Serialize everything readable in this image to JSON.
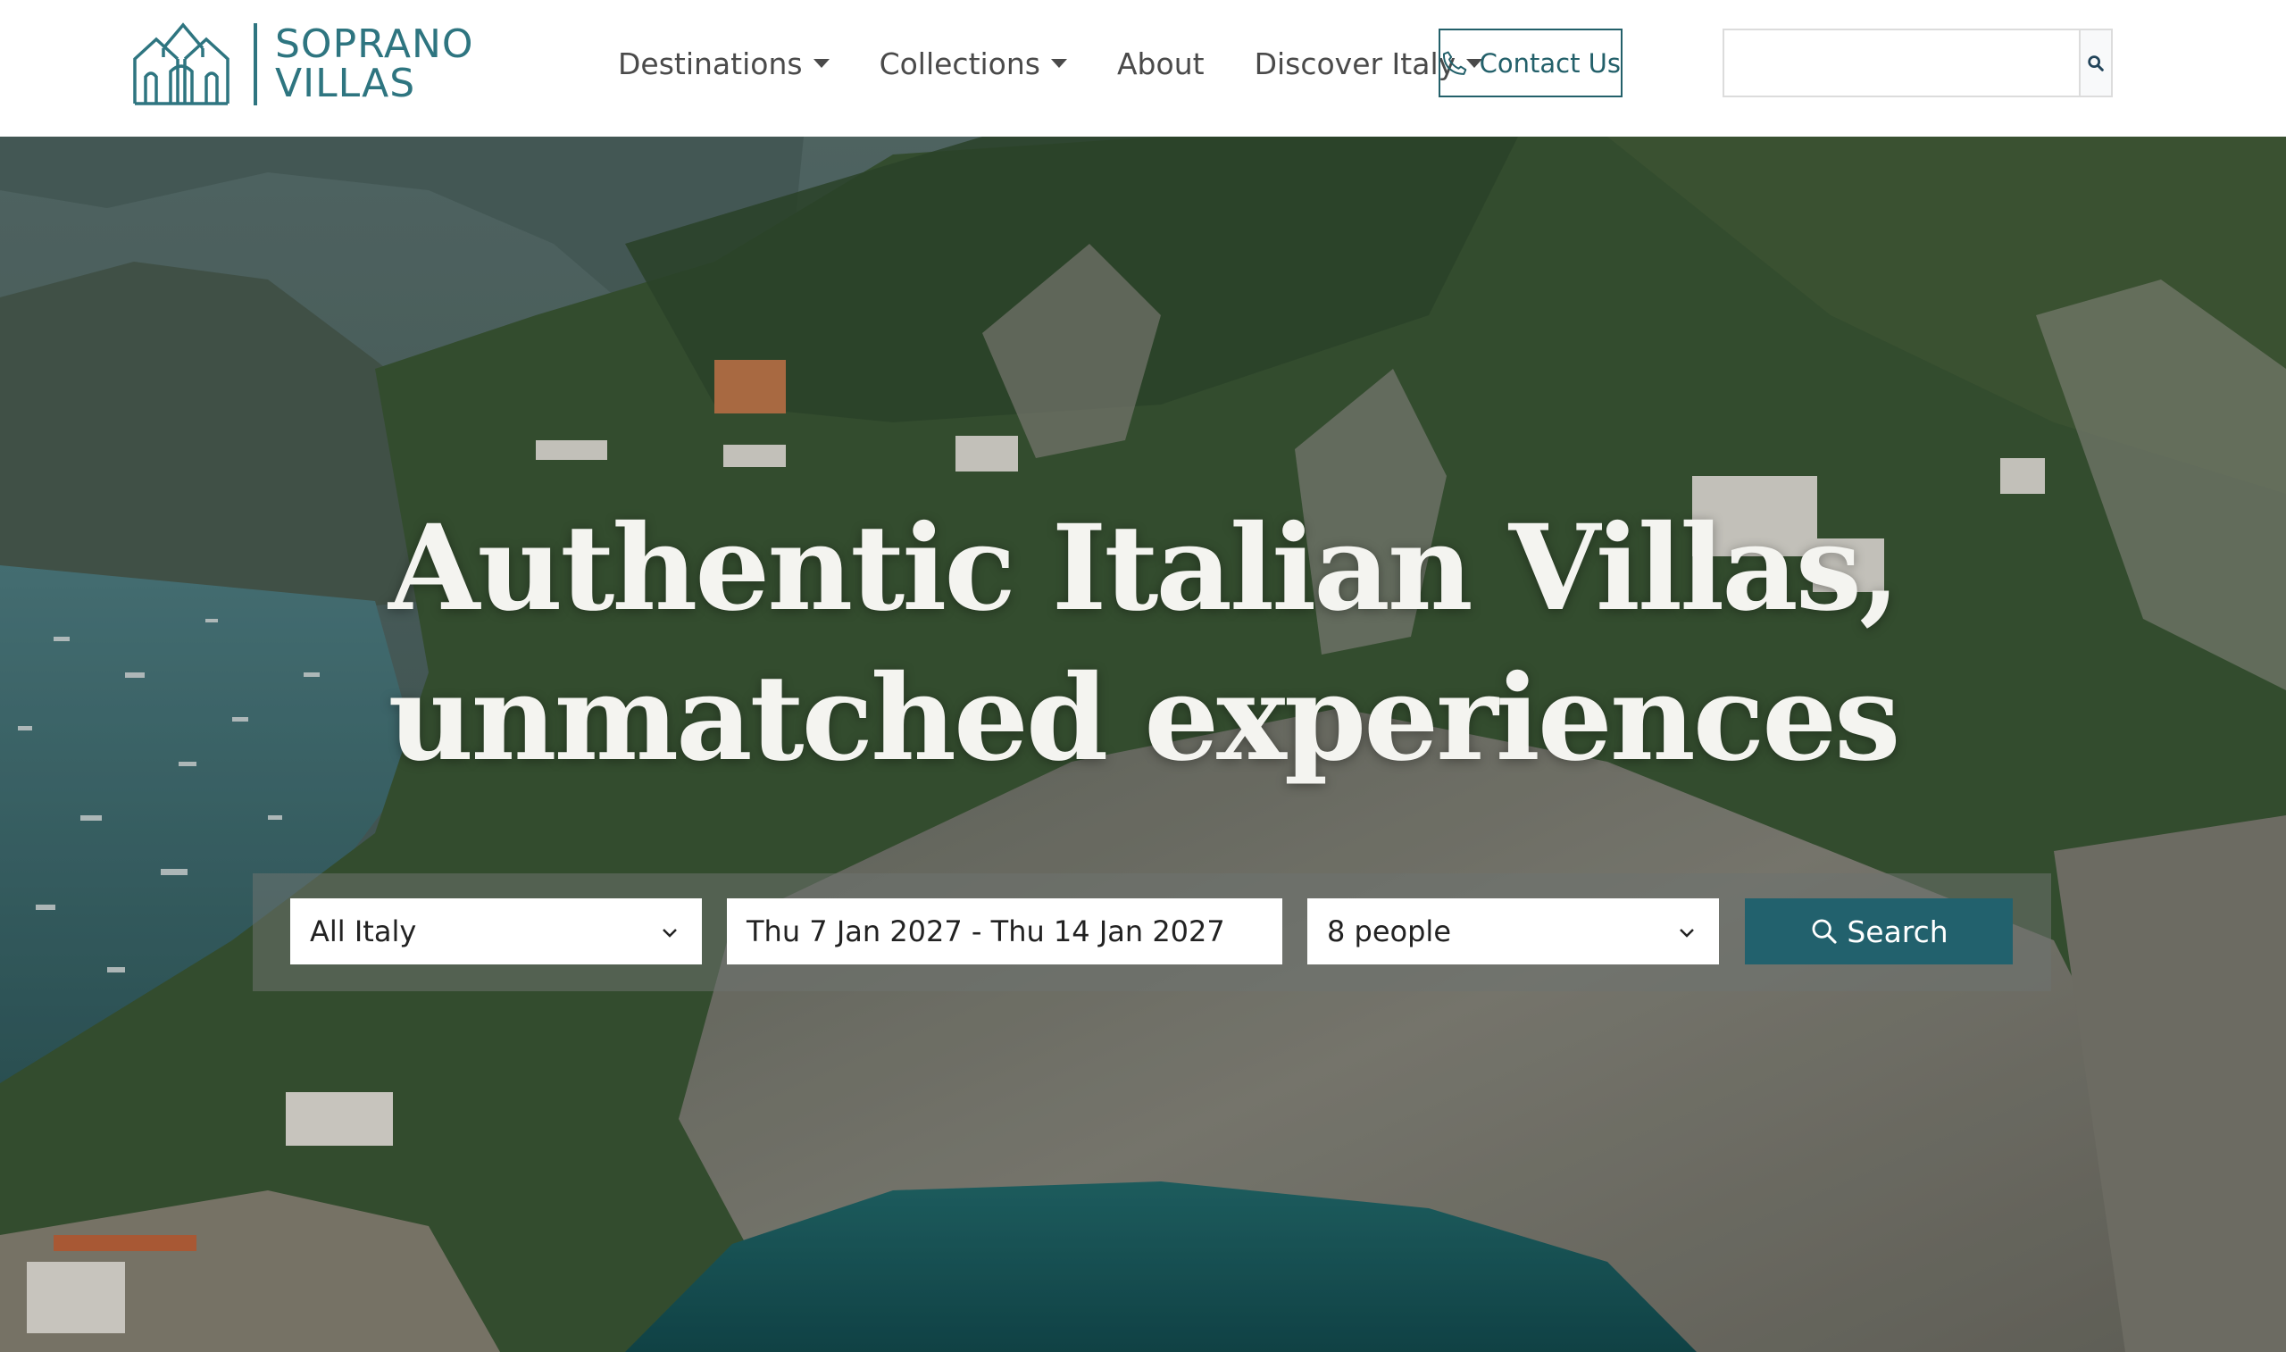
{
  "header": {
    "logo": {
      "line1": "SOPRANO",
      "line2": "VILLAS",
      "brand_color": "#2e7580"
    },
    "nav": [
      {
        "label": "Destinations",
        "has_dropdown": true
      },
      {
        "label": "Collections",
        "has_dropdown": true
      },
      {
        "label": "About",
        "has_dropdown": false
      },
      {
        "label": "Discover Italy",
        "has_dropdown": true
      }
    ],
    "contact_button": {
      "label": "Contact Us",
      "icon": "phone-icon"
    },
    "search": {
      "value": "",
      "placeholder": "",
      "icon": "search-icon"
    }
  },
  "hero": {
    "title_line1": "Authentic Italian Villas,",
    "title_line2": "unmatched experiences",
    "search_form": {
      "location": {
        "value": "All Italy",
        "icon": "chevron-down-icon"
      },
      "dates": {
        "value": "Thu 7 Jan 2027 - Thu 14 Jan 2027"
      },
      "guests": {
        "value": "8 people",
        "icon": "chevron-down-icon"
      },
      "submit": {
        "label": "Search",
        "icon": "search-icon",
        "color": "#22616d"
      }
    }
  }
}
